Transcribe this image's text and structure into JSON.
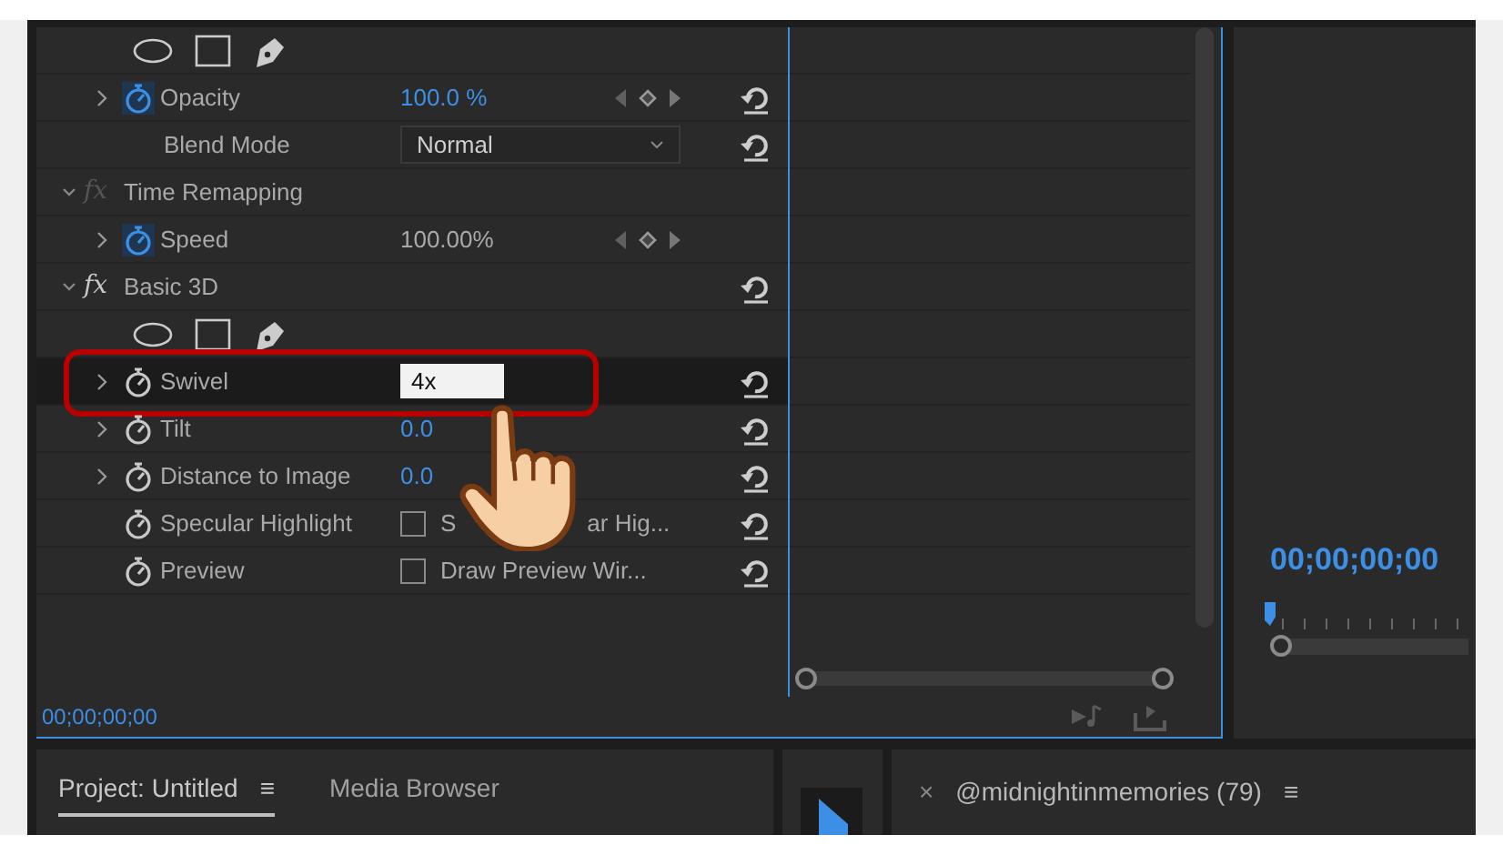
{
  "effect_rows": [
    {
      "kind": "shapes"
    },
    {
      "kind": "param",
      "label": "Opacity",
      "expandable": true,
      "stopwatch_active": true,
      "value": "100.0 %",
      "value_linked": true,
      "keyframe_nav": true,
      "reset": true
    },
    {
      "kind": "dropdown",
      "label": "Blend Mode",
      "value": "Normal",
      "reset": true
    },
    {
      "kind": "section",
      "badge": "fx",
      "fx_enabled": false,
      "label": "Time Remapping",
      "expanded": true,
      "reset": false
    },
    {
      "kind": "param",
      "label": "Speed",
      "expandable": true,
      "stopwatch_active": true,
      "value": "100.00%",
      "value_linked": false,
      "keyframe_nav": true,
      "reset": false
    },
    {
      "kind": "section",
      "badge": "fx",
      "fx_enabled": true,
      "label": "Basic 3D",
      "expanded": true,
      "reset": true
    },
    {
      "kind": "shapes"
    },
    {
      "kind": "input",
      "label": "Swivel",
      "expandable": true,
      "stopwatch_active": false,
      "value": "4x",
      "highlighted": true,
      "reset": true
    },
    {
      "kind": "param",
      "label": "Tilt",
      "expandable": true,
      "stopwatch_active": false,
      "value": "0.0",
      "value_linked": true,
      "keyframe_nav": false,
      "reset": true
    },
    {
      "kind": "param",
      "label": "Distance to Image",
      "expandable": true,
      "stopwatch_active": false,
      "value": "0.0",
      "value_linked": true,
      "keyframe_nav": false,
      "reset": true
    },
    {
      "kind": "checkbox",
      "label": "Specular Highlight",
      "expandable": false,
      "stopwatch_active": false,
      "checked": false,
      "value_parts": [
        "S",
        "ar Hig..."
      ],
      "reset": true
    },
    {
      "kind": "checkbox",
      "label": "Preview",
      "expandable": false,
      "stopwatch_active": false,
      "checked": false,
      "value_parts": [
        "Draw Preview Wir..."
      ],
      "reset": true
    }
  ],
  "effect_timecode": "00;00;00;00",
  "program_timecode": "00;00;00;00",
  "project_tabs": [
    {
      "label": "Project: Untitled",
      "menu": "≡",
      "selected": true
    },
    {
      "label": "Media Browser",
      "selected": false
    }
  ],
  "timeline_tab": {
    "close": "×",
    "label": "@midnightinmemories (79)",
    "menu": "≡"
  }
}
